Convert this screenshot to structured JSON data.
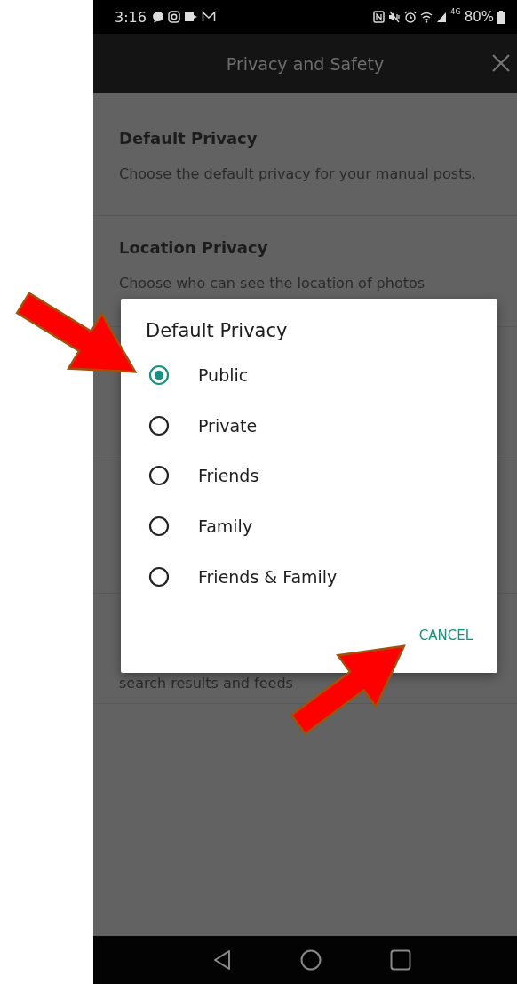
{
  "status_bar": {
    "time": "3:16",
    "network": "4G",
    "battery": "80%"
  },
  "header": {
    "title": "Privacy and Safety"
  },
  "settings": [
    {
      "title": "Default Privacy",
      "description": "Choose the default privacy for your manual posts."
    },
    {
      "title": "Location Privacy",
      "description": "Choose who can see the location of photos"
    },
    {
      "description": "search results and feeds"
    }
  ],
  "dialog": {
    "title": "Default Privacy",
    "options": [
      {
        "label": "Public",
        "selected": true
      },
      {
        "label": "Private",
        "selected": false
      },
      {
        "label": "Friends",
        "selected": false
      },
      {
        "label": "Family",
        "selected": false
      },
      {
        "label": "Friends & Family",
        "selected": false
      }
    ],
    "cancel": "CANCEL"
  }
}
